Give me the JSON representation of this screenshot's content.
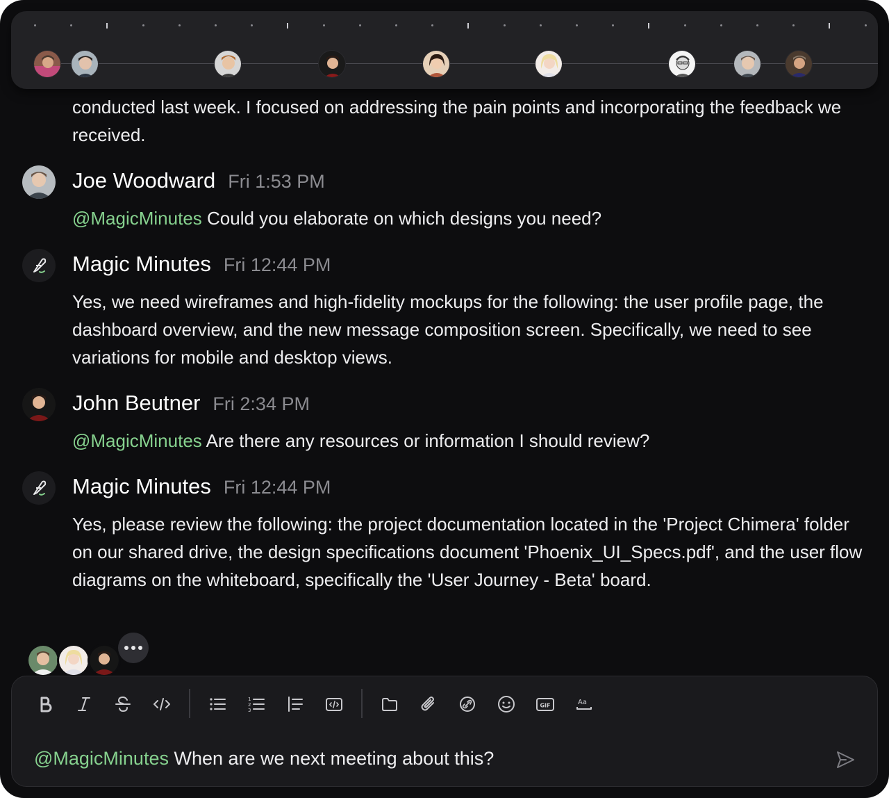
{
  "messages": [
    {
      "partial_text": "conducted last week. I focused on addressing the pain points and incorporating the feedback we received."
    },
    {
      "author": "Joe Woodward",
      "time": "Fri 1:53 PM",
      "mention": "@MagicMinutes",
      "text": " Could you elaborate on which designs you need?"
    },
    {
      "author": "Magic Minutes",
      "time": "Fri 12:44 PM",
      "text": "Yes, we need wireframes and high-fidelity mockups for the following: the user profile page, the dashboard overview, and the new message composition screen. Specifically, we need to see variations for mobile and desktop views."
    },
    {
      "author": "John Beutner",
      "time": "Fri 2:34 PM",
      "mention": "@MagicMinutes",
      "text": " Are there any resources or information I should review?"
    },
    {
      "author": "Magic Minutes",
      "time": "Fri 12:44 PM",
      "text": "Yes, please review the following: the project documentation located in the 'Project Chimera' folder on our shared drive, the design specifications document 'Phoenix_UI_Specs.pdf', and the user flow diagrams on the whiteboard, specifically the 'User Journey - Beta' board."
    }
  ],
  "composer": {
    "mention": "@MagicMinutes",
    "text": " When are we next meeting about this?",
    "toolbar": [
      "bold-icon",
      "italic-icon",
      "strikethrough-icon",
      "code-icon",
      "bullet-list-icon",
      "numbered-list-icon",
      "blockquote-icon",
      "code-block-icon",
      "folder-icon",
      "paperclip-icon",
      "link-icon",
      "emoji-icon",
      "gif-icon",
      "text-format-icon",
      "send-icon"
    ]
  },
  "colors": {
    "background": "#0d0d0f",
    "panel": "#222225",
    "mention": "#86d18e",
    "time": "#8b8b90"
  }
}
